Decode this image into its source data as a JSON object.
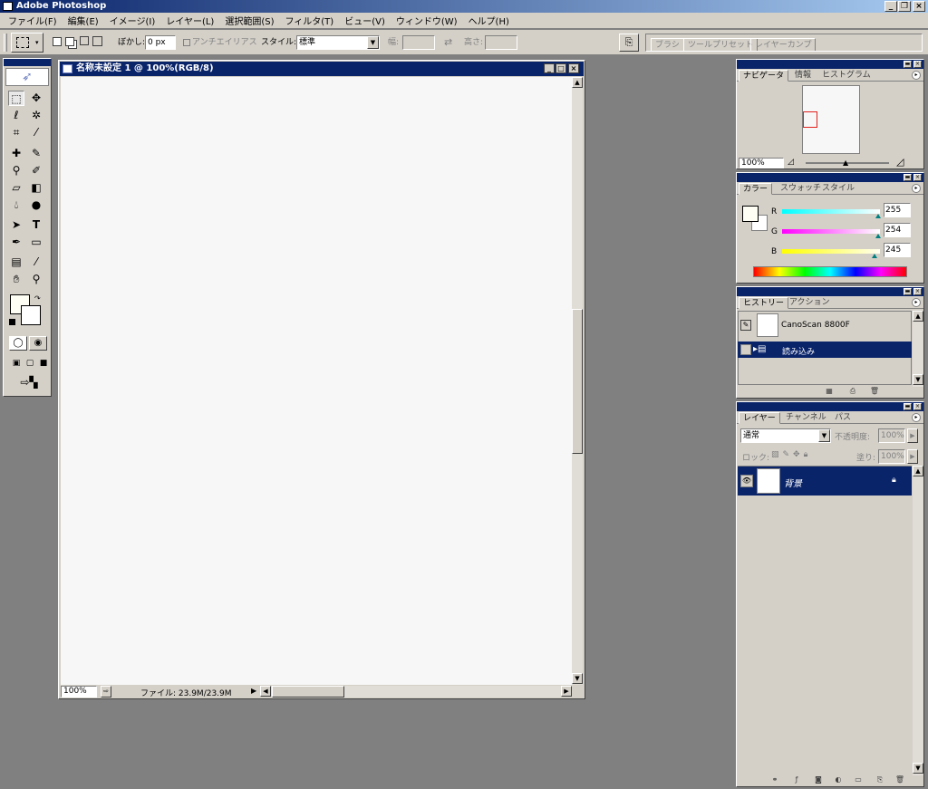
{
  "app": {
    "title": "Adobe Photoshop"
  },
  "window_buttons": {
    "minimize": "_",
    "restore": "❐",
    "close": "×"
  },
  "menu": [
    "ファイル(F)",
    "編集(E)",
    "イメージ(I)",
    "レイヤー(L)",
    "選択範囲(S)",
    "フィルタ(T)",
    "ビュー(V)",
    "ウィンドウ(W)",
    "ヘルプ(H)"
  ],
  "options": {
    "feather_label": "ぼかし:",
    "feather_value": "0 px",
    "antialias_label": "アンチエイリアス",
    "style_label": "スタイル:",
    "style_value": "標準",
    "width_label": "幅:",
    "height_label": "高さ:"
  },
  "dock_tabs": [
    "ブラシ",
    "ツールプリセット",
    "レイヤーカンプ"
  ],
  "document": {
    "title": "名称未設定 1 @ 100%(RGB/8)",
    "zoom": "100%",
    "file_info": "ファイル: 23.9M/23.9M"
  },
  "navigator": {
    "tabs": [
      "ナビゲータ",
      "情報",
      "ヒストグラム"
    ],
    "zoom": "100%"
  },
  "color": {
    "tabs": [
      "カラー",
      "スウォッチ",
      "スタイル"
    ],
    "r_label": "R",
    "g_label": "G",
    "b_label": "B",
    "r": "255",
    "g": "254",
    "b": "245",
    "fg_color": "#fffef5"
  },
  "history": {
    "tabs": [
      "ヒストリー",
      "アクション"
    ],
    "snapshot": "CanoScan 8800F",
    "step": "読み込み"
  },
  "layers": {
    "tabs": [
      "レイヤー",
      "チャンネル",
      "パス"
    ],
    "blend_mode": "通常",
    "opacity_label": "不透明度:",
    "opacity": "100%",
    "lock_label": "ロック:",
    "fill_label": "塗り:",
    "fill": "100%",
    "layer_name": "背景"
  }
}
